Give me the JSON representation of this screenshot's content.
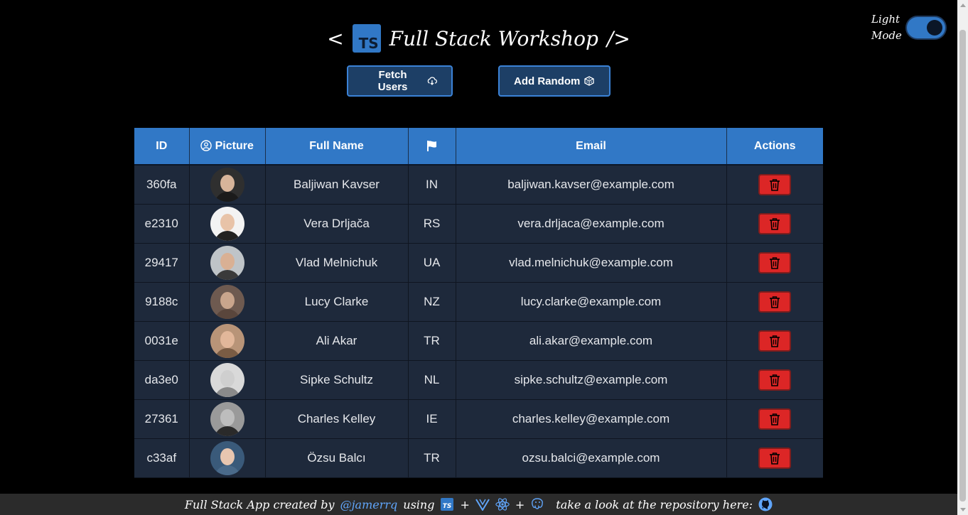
{
  "header": {
    "title_open": "<",
    "logo_text": "TS",
    "title": "Full Stack Workshop",
    "title_close": "/>",
    "fetch_label": "Fetch Users",
    "add_label": "Add Random"
  },
  "theme_toggle": {
    "line1": "Light",
    "line2": "Mode",
    "checked": true
  },
  "table": {
    "headers": {
      "id": "ID",
      "picture": "Picture",
      "full_name": "Full Name",
      "email": "Email",
      "actions": "Actions"
    },
    "rows": [
      {
        "id": "360fa",
        "name": "Baljiwan Kavser",
        "country": "IN",
        "email": "baljiwan.kavser@example.com",
        "skin": "#d7b49a",
        "shirt": "#1b1b1b",
        "bg": "#2f2f2f"
      },
      {
        "id": "e2310",
        "name": "Vera Drljača",
        "country": "RS",
        "email": "vera.drljaca@example.com",
        "skin": "#e8c3a8",
        "shirt": "#222222",
        "bg": "#f3f3f3"
      },
      {
        "id": "29417",
        "name": "Vlad Melnichuk",
        "country": "UA",
        "email": "vlad.melnichuk@example.com",
        "skin": "#d9b094",
        "shirt": "#3a3a3a",
        "bg": "#bfc4c8"
      },
      {
        "id": "9188c",
        "name": "Lucy Clarke",
        "country": "NZ",
        "email": "lucy.clarke@example.com",
        "skin": "#c9a58c",
        "shirt": "#5a463c",
        "bg": "#6e5a50"
      },
      {
        "id": "0031e",
        "name": "Ali Akar",
        "country": "TR",
        "email": "ali.akar@example.com",
        "skin": "#e2b79a",
        "shirt": "#7a5c44",
        "bg": "#b89478"
      },
      {
        "id": "da3e0",
        "name": "Sipke Schultz",
        "country": "NL",
        "email": "sipke.schultz@example.com",
        "skin": "#cfcfcf",
        "shirt": "#8a8a8a",
        "bg": "#d9d9d9"
      },
      {
        "id": "27361",
        "name": "Charles Kelley",
        "country": "IE",
        "email": "charles.kelley@example.com",
        "skin": "#bdbdbd",
        "shirt": "#2a2a2a",
        "bg": "#9a9a9a"
      },
      {
        "id": "c33af",
        "name": "Özsu Balcı",
        "country": "TR",
        "email": "ozsu.balci@example.com",
        "skin": "#e8c6b0",
        "shirt": "#4a6a8a",
        "bg": "#3a5a7a"
      }
    ]
  },
  "footer": {
    "text1": "Full Stack App created by",
    "author": "@jamerrq",
    "text2": "using",
    "plus": "+",
    "text3": "take a look at the repository here:"
  },
  "colors": {
    "accent": "#3178c6",
    "button_bg": "#1d3f66",
    "row_bg": "#1e293b",
    "delete": "#dc2626"
  }
}
